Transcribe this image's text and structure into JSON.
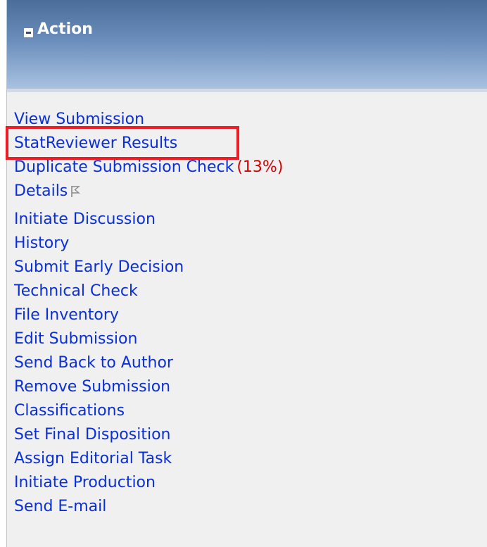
{
  "panel": {
    "title": "Action",
    "collapse_icon": "minus-box-icon",
    "header_colors": [
      "#4a6d99",
      "#a9c2e0"
    ],
    "link_color": "#0a2fd6"
  },
  "actions": [
    {
      "label": "View Submission"
    },
    {
      "label": "StatReviewer Results",
      "highlighted": true
    },
    {
      "label": "Duplicate Submission Check",
      "badge": "(13%)",
      "badge_color": "#d40000"
    },
    {
      "label": "Details",
      "icon": "flag-outline-icon"
    },
    {
      "label": "Initiate Discussion"
    },
    {
      "label": "History"
    },
    {
      "label": "Submit Early Decision"
    },
    {
      "label": "Technical Check"
    },
    {
      "label": "File Inventory"
    },
    {
      "label": "Edit Submission"
    },
    {
      "label": "Send Back to Author"
    },
    {
      "label": "Remove Submission"
    },
    {
      "label": "Classifications"
    },
    {
      "label": "Set Final Disposition"
    },
    {
      "label": "Assign Editorial Task"
    },
    {
      "label": "Initiate Production"
    },
    {
      "label": "Send E-mail"
    }
  ],
  "highlight_color": "#ee1c25"
}
